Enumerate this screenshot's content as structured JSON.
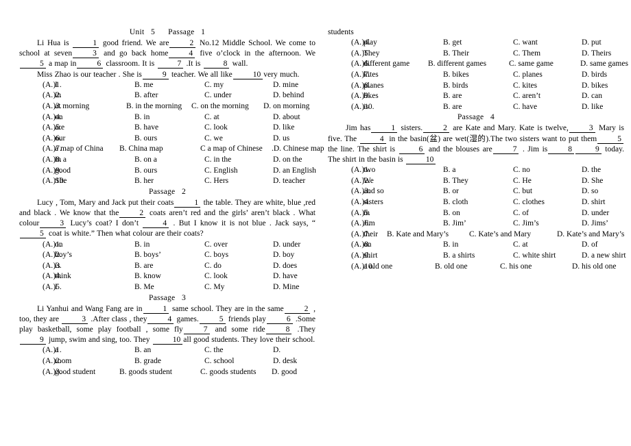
{
  "document": {
    "title_line": "Unit   5      Passage   1"
  },
  "left_column": {
    "passage1": {
      "heading": "Unit   5      Passage   1",
      "body_segments": [
        "Li Hua is ",
        "1",
        " good friend. We are",
        "2",
        " No.12 Middle School. We come to school at seven",
        "3",
        " and go back home",
        "4",
        " five o’clock in the afternoon. We",
        "5",
        " a map in",
        "6",
        " classroom. It is ",
        "7",
        " .It is ",
        "8",
        " wall."
      ],
      "para1_a": "Li Hua is ",
      "para1_b": " good friend. We are",
      "para1_c": " No.12 Middle School. We come to school at seven",
      "para1_d": " and go back home",
      "para1_e": " five o’clock in the afternoon. We",
      "para1_f": " a map in",
      "para1_g": " classroom. It is ",
      "para1_h": " .It is ",
      "para1_i": " wall.",
      "para2_a": "Miss Zhao is our teacher . She is",
      "para2_b": " teacher. We all like",
      "para2_c": "very much.",
      "blanks": [
        "1",
        "2",
        "3",
        "4",
        "5",
        "6",
        "7",
        "8",
        "9",
        "10"
      ],
      "options": [
        {
          "num": "1",
          "a": "A. I",
          "b": "B. me",
          "c": "C. my",
          "d": "D. mine"
        },
        {
          "num": "2",
          "a": "A. in",
          "b": "B. after",
          "c": "C. under",
          "d": "D. behind"
        },
        {
          "num": "3",
          "a": "A. at morning",
          "b": "B. in the morning",
          "c": "C. on the morning",
          "d": "D. on morning"
        },
        {
          "num": "4",
          "a": "A. on",
          "b": "B. in",
          "c": "C. at",
          "d": "D. about"
        },
        {
          "num": "5",
          "a": "A. are",
          "b": "B. have",
          "c": "C. look",
          "d": "D. like"
        },
        {
          "num": "6",
          "a": "A. our",
          "b": "B. ours",
          "c": "C. we",
          "d": "D. us"
        },
        {
          "num": "7",
          "a": "A. a map of China",
          "b": "B. China map",
          "c": "C a map of Chinese",
          "d": ".D. Chinese map"
        },
        {
          "num": "8",
          "a": "A. in a",
          "b": "B. on a",
          "c": "C. in the",
          "d": "D. on the"
        },
        {
          "num": "9",
          "a": "A. good",
          "b": "B. ours",
          "c": "C. English",
          "d": "D. an English"
        },
        {
          "num": "10",
          "a": "A. She",
          "b": "B. her",
          "c": "C. Hers",
          "d": "D. teacher"
        }
      ]
    },
    "passage2": {
      "heading": "Passage   2",
      "para_a": "Lucy , Tom, Mary and Jack put their coats",
      "para_b": " the table. They are white, blue ,red and black . We know that the",
      "para_c": " coats aren’t red and the girls’ aren’t black . What colour",
      "para_d": " Lucy’s coat? I don’t ",
      "para_e": " . But I know it is not blue . Jack says, “",
      "para_f": " coat is white.” Then what colour are their coats?",
      "options": [
        {
          "num": "1",
          "a": "A. on",
          "b": "B. in",
          "c": "C. over",
          "d": "D. under"
        },
        {
          "num": "2",
          "a": "A. boy’s",
          "b": "B. boys’",
          "c": "C. boys",
          "d": "D. boy"
        },
        {
          "num": "3",
          "a": "A. is",
          "b": "B. are",
          "c": "C. do",
          "d": "D. does"
        },
        {
          "num": "4",
          "a": "A. think",
          "b": "B. know",
          "c": "C. look",
          "d": "D. have"
        },
        {
          "num": "5",
          "a": "A. I",
          "b": "B. Me",
          "c": "C. My",
          "d": "D. Mine"
        }
      ]
    },
    "passage3": {
      "heading": "Passage   3",
      "para_a": "Li Yanhui and Wang Fang are in",
      "para_b": " same school. They are in the same",
      "para_c": " , too, they are ",
      "para_d": " .After class , they",
      "para_e": " games.",
      "para_f": " friends play",
      "para_g": " .Some play basketball, some play football , some fly",
      "para_h": " and some ride",
      "para_i": " .They ",
      "para_j": " jump, swim and sing, too. They ",
      "para_k": "all good students. They love their school.",
      "options_left": [
        {
          "num": "1",
          "a": "A. a",
          "b": "B. an",
          "c": "C. the",
          "d": "D."
        },
        {
          "num": "2",
          "a": "A. room",
          "b": "B. grade",
          "c": "C. school",
          "d": "D. desk"
        },
        {
          "num": "3",
          "a": "A. good student",
          "b": "B. goods student",
          "c": "C. goods students",
          "d": "D.    good"
        }
      ]
    }
  },
  "right_column": {
    "passage3_continued": {
      "orphan_word": "students",
      "options": [
        {
          "num": "4",
          "a": "A. play",
          "b": "B. get",
          "c": "C. want",
          "d": "D. put"
        },
        {
          "num": "5",
          "a": "A. They",
          "b": "B. Their",
          "c": "C. Them",
          "d": "D. Theirs"
        },
        {
          "num": "6",
          "a": "A. different game",
          "b": "B. different games",
          "c": "C. same game",
          "d": "D. same games"
        },
        {
          "num": "7",
          "a": "A. kites",
          "b": "B. bikes",
          "c": "C. planes",
          "d": "D. birds"
        },
        {
          "num": "8",
          "a": "A. planes",
          "b": "B. birds",
          "c": "C. kites",
          "d": "D. bikes"
        },
        {
          "num": "9",
          "a": "A. likes",
          "b": "B. are",
          "c": "C. aren’t",
          "d": "D. can"
        },
        {
          "num": "10",
          "a": "A. is",
          "b": "B. are",
          "c": "C. have",
          "d": "D. like"
        }
      ]
    },
    "passage4": {
      "heading": "Passage   4",
      "para_a": "Jim has",
      "para_b": " sisters.",
      "para_c": " are Kate and Mary. Kate is twelve,",
      "para_d": " Mary is five. The ",
      "para_e": " in the basin(盆) are wet(湿的).The two sisters want to put them",
      "para_f": " the line. The shirt is ",
      "para_g": " and the blouses are",
      "para_h": " . Jim is",
      "para_i": " today. The shirt in the basin is ",
      "options": [
        {
          "num": "1",
          "a": "A. two",
          "b": "B. a",
          "c": "C. no",
          "d": "D. the"
        },
        {
          "num": "2",
          "a": "A. We",
          "b": "B. They",
          "c": "C. He",
          "d": "D. She"
        },
        {
          "num": "3",
          "a": "A. and so",
          "b": "B. or",
          "c": "C. but",
          "d": "D. so"
        },
        {
          "num": "4",
          "a": "A. sisters",
          "b": "B. cloth",
          "c": "C. clothes",
          "d": "D. shirt"
        },
        {
          "num": "5",
          "a": "A. in",
          "b": "B. on",
          "c": "C. of",
          "d": "D. under"
        },
        {
          "num": "6",
          "a": "A. Jim",
          "b": "B. Jim’",
          "c": "C. Jim’s",
          "d": "D. Jims’"
        },
        {
          "num": "7",
          "a": "A. their",
          "b": "B. Kate and Mary’s",
          "c": "C. Kate’s and Mary",
          "d": "D. Kate’s and Mary’s"
        },
        {
          "num": "8",
          "a": "A. on",
          "b": "B. in",
          "c": "C. at",
          "d": "D. of"
        },
        {
          "num": "9",
          "a": "A. shirt",
          "b": "B. a shirts",
          "c": "C. white shirt",
          "d": "D. a new shirt"
        },
        {
          "num": "10",
          "a": "A. a old one",
          "b": "B. old one",
          "c": "C. his one",
          "d": "D. his old one"
        }
      ]
    }
  }
}
